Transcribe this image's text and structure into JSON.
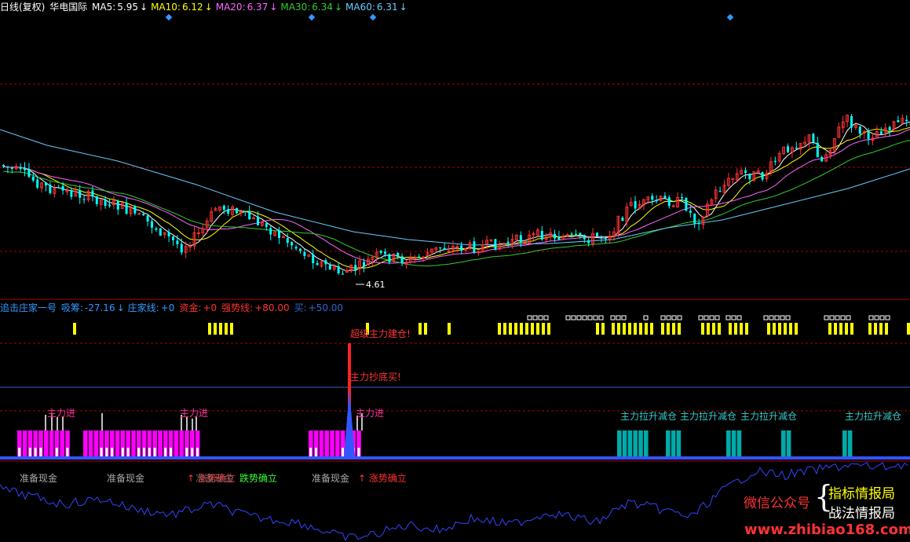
{
  "main_header": {
    "title": "日线(复权)",
    "stock": "华电国际",
    "ma": [
      {
        "label": "MA5:",
        "value": "5.95",
        "arrow": "↓",
        "color": "#ffffff"
      },
      {
        "label": "MA10:",
        "value": "6.12",
        "arrow": "↓",
        "color": "#ffff00"
      },
      {
        "label": "MA20:",
        "value": "6.37",
        "arrow": "↓",
        "color": "#ff66ff"
      },
      {
        "label": "MA30:",
        "value": "6.34",
        "arrow": "↓",
        "color": "#33cc33"
      },
      {
        "label": "MA60:",
        "value": "6.31",
        "arrow": "↓",
        "color": "#66ccff"
      }
    ]
  },
  "low_marker": "4.61",
  "indicator_header": {
    "name": "追击庄家一号",
    "items": [
      {
        "label": "吸筹:",
        "value": "-27.16",
        "arrow": "↓",
        "color": "#3399ff"
      },
      {
        "label": "庄家线:",
        "value": "+0",
        "arrow": "",
        "color": "#3399ff"
      },
      {
        "label": "资金:",
        "value": "+0",
        "arrow": "",
        "color": "#ff3333"
      },
      {
        "label": "强势线:",
        "value": "+80.00",
        "arrow": "",
        "color": "#ff3333"
      },
      {
        "label": "买:",
        "value": "+50.00",
        "arrow": "",
        "color": "#3366cc"
      }
    ]
  },
  "signals": {
    "super_build": "超级主力建仓!",
    "bottom_buy": "主力抄底买!",
    "main_in": "主力进",
    "pull_reduce": "主力拉升减仓",
    "prepare_cash": "准备现金",
    "up_confirm": "↑ 涨势确立",
    "down_confirm": "跌势确立"
  },
  "watermark": {
    "wechat": "微信公众号",
    "brace": "{",
    "name1": "指标情报局",
    "name2": "战法情报局",
    "site": "www.zhibiao168.com"
  },
  "colors": {
    "up": "#ff3333",
    "down": "#00ffff",
    "ma5": "#ffffff",
    "ma10": "#ffff00",
    "ma20": "#ff66ff",
    "ma30": "#33cc33",
    "ma60": "#66ccff",
    "grid": "#aa0000",
    "magenta_bar": "#ff00ff",
    "teal_bar": "#00aaaa",
    "yellow_bar": "#ffff00",
    "blue_line": "#3355ff"
  }
}
